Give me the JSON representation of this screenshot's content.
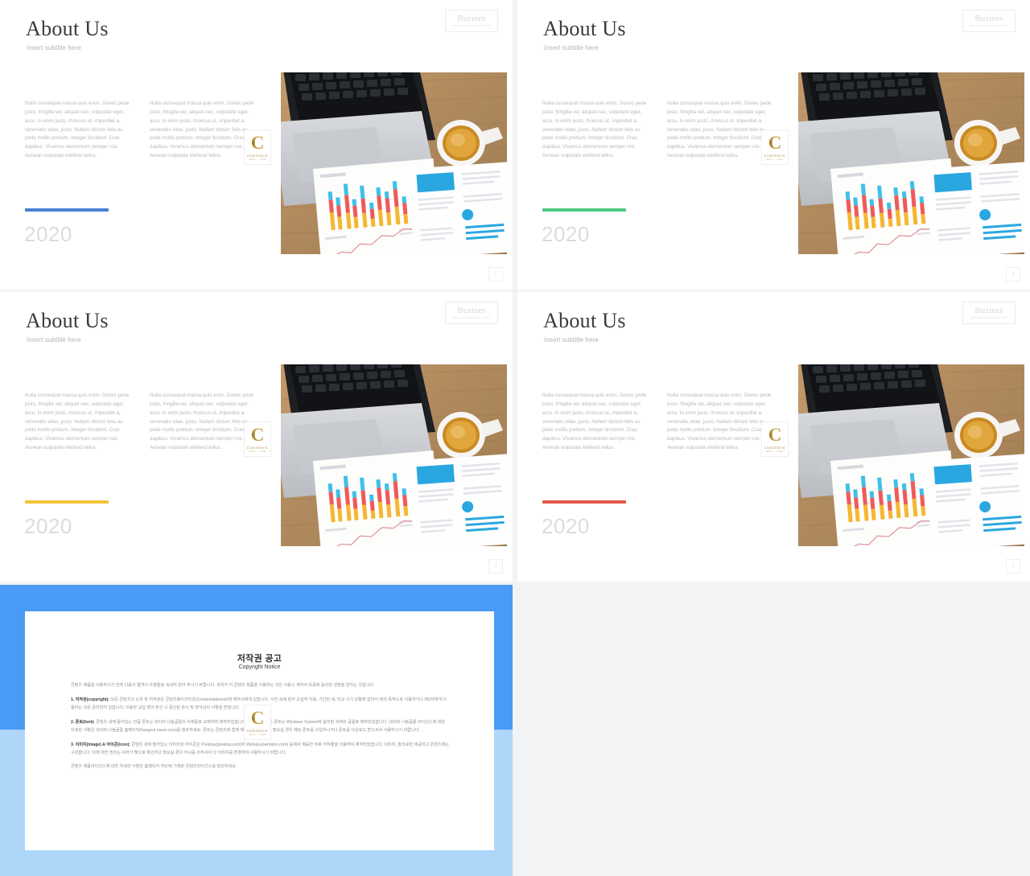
{
  "deck": {
    "background_color": "#f2f3f5",
    "slide_background": "#ffffff"
  },
  "logo": {
    "name": "Buzines",
    "tagline": "Business Presentation Slide"
  },
  "watermark": {
    "letter": "C",
    "line1": "CONTENTS",
    "line2": "MALL . COM"
  },
  "slide_common": {
    "title": "About Us",
    "subtitle": "Insert subtitle here",
    "year": "2020",
    "body_left": "Nulla consequat massa quis enim. Donec pede justo, fringilla vel, aliquet nec, vulputate eget, arcu. In enim justo, rhoncus ut, imperdiet a, venenatis vitae, justo. Nullam dictum felis eu pede mollis pretium. Integer tincidunt. Cras dapibus. Vivamus elementum semper nisi. Aenean vulputate eleifend tellus.",
    "body_right": "Nulla consequat massa quis enim. Donec pede justo, fringilla vel, aliquet nec, vulputate eget, arcu. In enim justo, rhoncus ut, imperdiet a, venenatis vitae, justo. Nullam dictum felis eu pede mollis pretium. Integer tincidunt. Cras dapibus. Vivamus elementum semper nisi. Aenean vulputate eleifend tellus."
  },
  "slides": [
    {
      "page_number": "2",
      "accent_color": "#4a7fd4"
    },
    {
      "page_number": "3",
      "accent_color": "#4dc97f"
    },
    {
      "page_number": "4",
      "accent_color": "#f2c437"
    },
    {
      "page_number": "5",
      "accent_color": "#e4564a"
    }
  ],
  "copyright_slide": {
    "frame_top_color": "#4a9bf5",
    "frame_bottom_color": "#aed6f9",
    "title_ko": "저작권 공고",
    "title_en": "Copyright Notice",
    "intro": "콘텐츠 제품을 사용하시기 전에 다음의 협약서 조항들을 세세히 읽어 주시기 바랍니다. 귀하가 이 콘텐츠 제품을 사용하는 것은 사용시 계약서 보증에 동의와 성명을 알리는 것입니다.",
    "section1_label": "1. 저작권(copyright):",
    "section1_text": " 모든 콘텐츠의 소유 및 저작권은 콘텐츠메이크아웃(Contentstakeout)에 제작사에게 있습니다. 사진 속에 담아 교섭적 이용, 기간한 세, 비교 사기 상황에 없어서 영리 목적으로 이용하거나 제3자에게 이용하는 것은 금지되어 있습니다. 이용한 교섭 명이 받긴 시 중인된 판시 및 명식상의 사항을 받습니다.",
    "section2_label": "2. 폰트(font):",
    "section2_text": " 콘텐츠 내에 들어있는 한글 폰트는 네이버 나눔글꼴의 서체들로 교체하여 제작되었습니다. 한글 외의 모든 폰트는 Windows System에 설치된 서체의 글꼴로 제작되었습니다. 네이버 나눔글꼴 라이선스에 대한 자세한 사항은 네이버 나눔글꼴 홈페이지(hangeul.naver.com)를 참조하세요. 폰트는 콘텐츠에 함께 제공되지 않으므로 필요실 경우 해당 폰트를 구입하시거나 폰트를 다운로드 받으셔서 사용하시기 바랍니다.",
    "section3_label": "3. 이미지(image) & 아이콘(icon):",
    "section3_text": " 콘텐츠 내에 들어있는 이미지와 아이콘은 Pixabay(pixabay.com)와 Webalys(webalys.com) 등에서 제공한 무료 저작물을 이용하여 제작되었습니다. 이미지, 참조로만 제공되고 콘텐츠에는 구성합니다. 이에 대한 권리는 귀하가 맺으로 확인하고 필요실 경우 아시를 쓰주셔서 다 이미지를 변경하여 사용하시기 바랍니다.",
    "outro": "콘텐츠 제품라이선스에 대한 자세한 사항은 홈페이지 하단에 기재된 콘텐츠라이선스를 참조하세요."
  }
}
